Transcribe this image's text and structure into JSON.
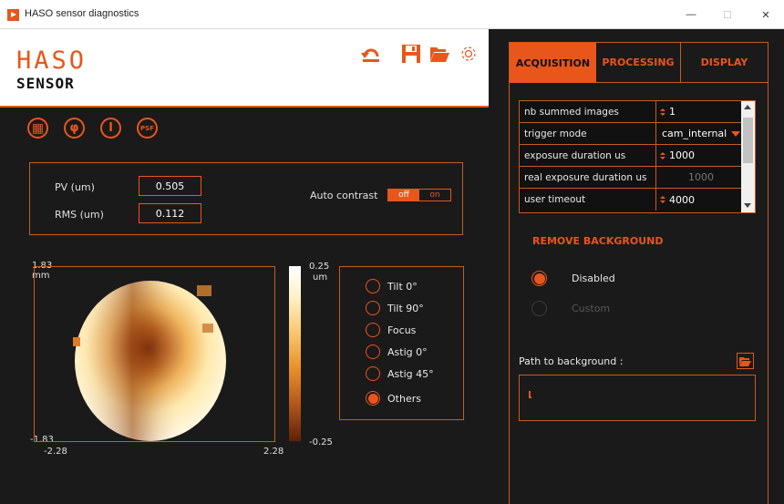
{
  "window": {
    "title": "HASO sensor diagnostics",
    "minimize": "—",
    "maximize": "☐",
    "close": "✕"
  },
  "brand": {
    "line1": "HASO",
    "line2": "SENSOR"
  },
  "toolbar": {
    "icons": [
      "undo-icon",
      "save-icon",
      "open-folder-icon",
      "settings-gear-icon"
    ]
  },
  "view_buttons": [
    {
      "name": "grid-view",
      "label": "▦"
    },
    {
      "name": "phase-view",
      "label": "φ"
    },
    {
      "name": "intensity-view",
      "label": "I"
    },
    {
      "name": "psf-view",
      "label": "PSF"
    }
  ],
  "metrics": {
    "pv_label": "PV (um)",
    "pv_value": "0.505",
    "rms_label": "RMS (um)",
    "rms_value": "0.112",
    "auto_contrast_label": "Auto contrast",
    "toggle_off": "off",
    "toggle_on": "on",
    "toggle_state": "off"
  },
  "plot": {
    "y_top": "1.83",
    "y_unit": "mm",
    "y_bottom": "-1.83",
    "x_left": "-2.28",
    "x_right": "2.28",
    "colorbar_max": "0.25",
    "colorbar_unit": "um",
    "colorbar_min": "-0.25"
  },
  "modes": {
    "items": [
      "Tilt 0°",
      "Tilt 90°",
      "Focus",
      "Astig 0°",
      "Astig 45°",
      "Others"
    ],
    "selected": "Others"
  },
  "tabs": {
    "acquisition": "ACQUISITION",
    "processing": "PROCESSING",
    "display": "DISPLAY",
    "active": "ACQUISITION"
  },
  "params": [
    {
      "name": "nb summed images",
      "value": "1"
    },
    {
      "name": "trigger mode",
      "value": "cam_internal"
    },
    {
      "name": "exposure duration us",
      "value": "1000"
    },
    {
      "name": "real exposure duration us",
      "value": "1000"
    },
    {
      "name": "user timeout",
      "value": "4000"
    }
  ],
  "background": {
    "title": "REMOVE BACKGROUND",
    "disabled_label": "Disabled",
    "custom_label": "Custom",
    "selected": "Disabled",
    "path_label": "Path to background :",
    "path_value": ""
  },
  "colors": {
    "accent": "#e8561c",
    "panel_bg": "#1a1a1a",
    "header_bg": "#ffffff"
  }
}
